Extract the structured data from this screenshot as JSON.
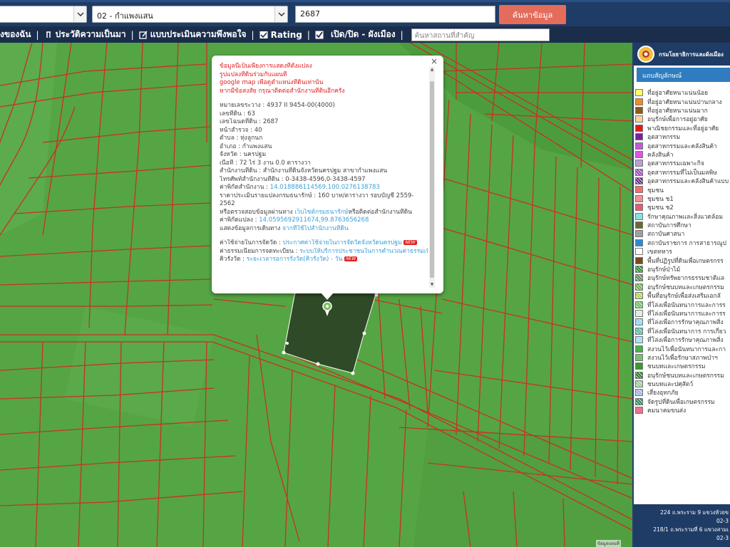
{
  "header": {
    "amphoe_select": "02 - กำแพงแสน",
    "parcel_input": "2687",
    "search_button": "ค้นหาข้อมูล"
  },
  "nav": {
    "items": [
      {
        "label": "งของฉัน"
      },
      {
        "label": "ประวัติความเป็นมา"
      },
      {
        "label": "แบบประเมินความพึงพอใจ"
      },
      {
        "label": "Rating"
      },
      {
        "label": "เปิด/ปิด - ผังเมือง"
      }
    ],
    "search_placeholder": "ค้นหาสถานที่สำคัญ"
  },
  "popup": {
    "warning": [
      "ข้อมูลนี้เป็นเพียงการแสดงที่ตั้งแปลง",
      "รูปแปลงที่ดินร่วมกับแผนที่",
      "google map เพื่อดูตำแหน่งที่ดินเท่านั้น",
      "หากมีข้อสงสัย กรุณาติดต่อสำนักงานที่ดินอีกครั้ง"
    ],
    "fields": [
      {
        "label": "หมายเลขระวาง",
        "value": "4937 II 9454-00(4000)"
      },
      {
        "label": "เลขที่ดิน",
        "value": "63"
      },
      {
        "label": "เลขโฉนดที่ดิน",
        "value": "2687"
      },
      {
        "label": "หน้าสำรวจ",
        "value": "40"
      },
      {
        "label": "ตำบล",
        "value": "ทุ่งลูกนก"
      },
      {
        "label": "อำเภอ",
        "value": "กำแพงแสน"
      },
      {
        "label": "จังหวัด",
        "value": "นครปฐม"
      },
      {
        "label": "เนื้อที่",
        "value": "72 ไร่ 3 งาน 0.0 ตารางวา"
      },
      {
        "label": "สำนักงานที่ดิน",
        "value": "สำนักงานที่ดินจังหวัดนครปฐม สาขากำแพงแสน"
      },
      {
        "label": "โทรศัพท์สำนักงานที่ดิน",
        "value": "0-3438-4596,0-3438-4597"
      },
      {
        "label": "ค่าพิกัดสำนักงาน",
        "value": "14.018886114569,100.0276138783"
      },
      {
        "label": "ราคาประเมินรายแปลงกรมธนารักษ์",
        "value": "160 บาท/ตารางวา รอบบัญชี 2559-2562"
      }
    ],
    "check_text": "หรือตรวจสอบข้อมูลผ่านทาง",
    "check_link": "เว็บไซต์กรมธนารักษ์",
    "check_tail": "หรือติดต่อสำนักงานที่ดิน",
    "coord_label": "ค่าพิกัดแปลง",
    "coord_value": "14.0595692911674,99.8763656268",
    "route_label": "แสดงข้อมูลการเดินทาง",
    "route_link": "จากที่ใช้ไปสำนักงานที่ดิน",
    "extra": [
      {
        "label": "ค่าใช้จ่ายในการจัดวัด",
        "value": "ประกาศค่าใช้จ่ายในการจัดวัดจังหวัดนครปฐม",
        "badge": "NEW"
      },
      {
        "label": "ค่าธรรมเนียมการจดทะเบียน",
        "value": "ระบบให้บริการประชาชนในการคำนวณค่าธรรมเนียม",
        "badge": "NEW"
      },
      {
        "label": "คิวรังวัด",
        "value": "ระยะเวลารอการรังวัด(คิวรังวัด) - วัน",
        "badge": "NEW"
      }
    ],
    "close": "×"
  },
  "legend": {
    "title": "กรมโยธาธิการและผังเมือง",
    "subtitle": "แถบสัญลักษณ์",
    "items": [
      {
        "label": "ที่อยู่อาศัยหนาแน่นน้อย",
        "color": "#ffff66"
      },
      {
        "label": "ที่อยู่อาศัยหนาแน่นปานกลาง",
        "color": "#f08c24"
      },
      {
        "label": "ที่อยู่อาศัยหนาแน่นมาก",
        "color": "#8a5a1e"
      },
      {
        "label": "อนุรักษ์เพื่อการอยู่อาศัย",
        "color": "#f8d49a"
      },
      {
        "label": "พาณิชยกรรมและที่อยู่อาศัย",
        "color": "#e01818"
      },
      {
        "label": "อุตสาหกรรม",
        "color": "#7a1fa0"
      },
      {
        "label": "อุตสาหกรรมและคลังสินค้า",
        "color": "#c45ad6"
      },
      {
        "label": "คลังสินค้า",
        "color": "#e052e8"
      },
      {
        "label": "อุตสาหกรรมเฉพาะกิจ",
        "color": "#b8a0d8"
      },
      {
        "label": "อุตสาหกรรมที่ไม่เป็นมลพิษ",
        "color": "#9a4ab8",
        "hatch": true
      },
      {
        "label": "อุตสาหกรรมและคลังสินค้าแบบ",
        "color": "#6a2a8a",
        "hatch": true
      },
      {
        "label": "ชุมชน",
        "color": "#f46e6e"
      },
      {
        "label": "ชุมชน ช1",
        "color": "#f49090"
      },
      {
        "label": "ชุมชน ช2",
        "color": "#e85a7a"
      },
      {
        "label": "รักษาคุณภาพและสิ่งแวดล้อม",
        "color": "#8ae0e0"
      },
      {
        "label": "สถาบันการศึกษา",
        "color": "#6a6a2a"
      },
      {
        "label": "สถาบันศาสนา",
        "color": "#a0a0a0"
      },
      {
        "label": "สถาบันราชการ การสาธารณูป",
        "color": "#2a8ad8"
      },
      {
        "label": "เขตทหาร",
        "color": "#ffffff"
      },
      {
        "label": "พื้นที่ปฏิรูปที่ดินเพื่อเกษตรกรร",
        "color": "#7a4a1a"
      },
      {
        "label": "อนุรักษ์ป่าไม้",
        "color": "#2a8a2a",
        "hatch": true
      },
      {
        "label": "อนุรักษ์ทรัพยากรธรรมชาติแล",
        "color": "#5a8a5a",
        "hatch": true
      },
      {
        "label": "อนุรักษ์ชนบทและเกษตรกรรม",
        "color": "#6ab04a",
        "hatch": true
      },
      {
        "label": "พื้นที่อนุรักษ์เพื่อส่งเสริมเอกลั",
        "color": "#b0d050",
        "hatch": true
      },
      {
        "label": "ที่โล่งเพื่อนันทนาการและการร",
        "color": "#5ac85a",
        "hatch": true
      },
      {
        "label": "ที่โล่งเพื่อนันทนาการและการร",
        "color": "#d0ecd0",
        "hatch": true
      },
      {
        "label": "ที่โล่งเพื่อการรักษาคุณภาพสิ่ง",
        "color": "#8ad0f0",
        "hatch": true
      },
      {
        "label": "ที่โล่งเพื่อนันทนาการ การเกี่ยว",
        "color": "#4ac0a0",
        "hatch": true
      },
      {
        "label": "ที่โล่งเพื่อการรักษาคุณภาพสิ่ง",
        "color": "#b0e0f8"
      },
      {
        "label": "สงวนไว้เพื่อนันทนาการและกา",
        "color": "#4ab04a"
      },
      {
        "label": "สงวนไว้เพื่อรักษาสภาพป่าฯ",
        "color": "#78c078"
      },
      {
        "label": "ชนบทและเกษตรกรรม",
        "color": "#3a9a2a"
      },
      {
        "label": "อนุรักษ์ชนบทและเกษตรกรรม",
        "color": "#2a7a2a",
        "hatch": true
      },
      {
        "label": "ชนบทและปศุสัตว์",
        "color": "#9ac8a0",
        "hatch": true
      },
      {
        "label": "เสี่ยงอุทกภัย",
        "color": "#a0b0e0",
        "hatch": true
      },
      {
        "label": "จัดรูปที่ดินเพื่อเกษตรกรรม",
        "color": "#2a8a5a",
        "hatch": true
      },
      {
        "label": "คมนาคมขนส่ง",
        "color": "#f07090"
      }
    ],
    "footer": [
      "224 ถ.พระราม 9 แขวงห้วยข",
      "02-3",
      "218/1 ถ.พระรามที่ 6 แขวงสามเ",
      "02-3"
    ]
  },
  "map": {
    "attribution": "ข้อมูลแผนที่",
    "colors": {
      "field": "#56a646",
      "boundary": "#c8321e",
      "selected": "#2f4a26"
    }
  }
}
